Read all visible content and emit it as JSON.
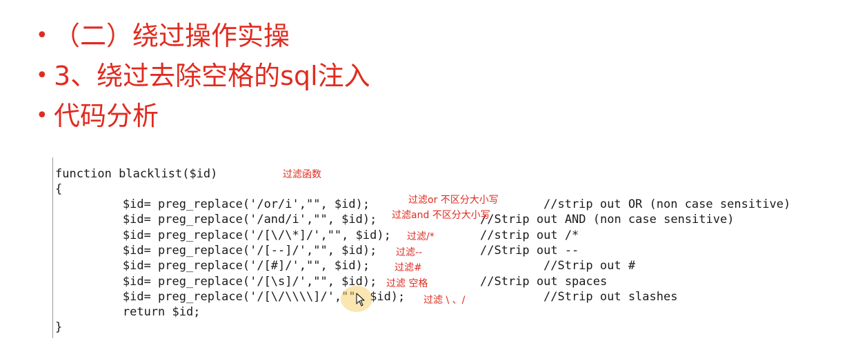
{
  "bullets": [
    "（二）绕过操作实操",
    "3、绕过去除空格的sql注入",
    "代码分析"
  ],
  "bullet_glyph": "•",
  "code": {
    "lines": [
      "function blacklist($id)",
      "{",
      "        $id= preg_replace('/or/i',\"\", $id);",
      "        $id= preg_replace('/and/i',\"\", $id);",
      "        $id= preg_replace('/[\\/\\*]/',\"\", $id);",
      "        $id= preg_replace('/[--]/',\"\", $id);",
      "        $id= preg_replace('/[#]/',\"\", $id);",
      "        $id= preg_replace('/[\\s]/',\"\", $id);",
      "        $id= preg_replace('/[\\/\\\\\\\\]/',\"\", $id);",
      "        return $id;",
      "}"
    ],
    "comments": [
      "//strip out OR (non case sensitive)",
      "//Strip out AND (non case sensitive)",
      "//strip out /*",
      "//Strip out --",
      "//Strip out #",
      "//Strip out spaces",
      "//Strip out slashes"
    ]
  },
  "annotations": [
    "过滤函数",
    "过滤or 不区分大小写",
    "过滤and 不区分大小写",
    "过滤/*",
    "过滤--",
    "过滤#",
    "过滤 空格",
    "过滤 \\ 、/"
  ],
  "colors": {
    "accent": "#e02b20",
    "code_text": "#1a1a1a",
    "cursor_halo": "#f5c850"
  },
  "icons": {
    "cursor": "mouse-pointer-icon"
  }
}
